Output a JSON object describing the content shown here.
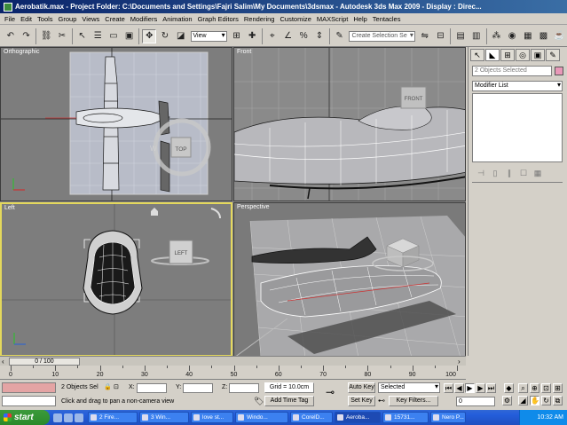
{
  "window": {
    "title": "Aerobatik.max   - Project Folder: C:\\Documents and Settings\\Fajri Salim\\My Documents\\3dsmax   - Autodesk 3ds Max  2009      - Display : Direc..."
  },
  "menu": [
    "File",
    "Edit",
    "Tools",
    "Group",
    "Views",
    "Create",
    "Modifiers",
    "Animation",
    "Graph Editors",
    "Rendering",
    "Customize",
    "MAXScript",
    "Help",
    "Tentacles"
  ],
  "toolbar": {
    "ref_coord": "View",
    "selection_set_placeholder": "Create Selection Se"
  },
  "viewports": {
    "top_left": {
      "label": "Orthographic",
      "cube": "TOP"
    },
    "top_right": {
      "label": "Front",
      "cube": "FRONT"
    },
    "bottom_left": {
      "label": "Left",
      "cube": "LEFT"
    },
    "bottom_right": {
      "label": "Perspective"
    }
  },
  "command_panel": {
    "selection_name": "2 Objects Selected",
    "modifier_list": "Modifier List",
    "swatch_color": "#e898b8"
  },
  "timeline": {
    "frame_display": "0 / 100",
    "ticks": [
      "0",
      "10",
      "20",
      "30",
      "40",
      "50",
      "60",
      "70",
      "80",
      "90",
      "100"
    ]
  },
  "status": {
    "selection": "2 Objects Sel",
    "x_label": "X:",
    "y_label": "Y:",
    "z_label": "Z:",
    "grid": "Grid = 10.0cm",
    "prompt": "Click and drag to pan a non-camera view",
    "add_time_tag": "Add Time Tag",
    "auto_key": "Auto Key",
    "set_key": "Set Key",
    "key_mode": "Selected",
    "key_filters": "Key Filters...",
    "current_frame": "0"
  },
  "taskbar": {
    "start": "start",
    "tasks": [
      "2 Fire...",
      "3 Win...",
      "love st...",
      "Windo...",
      "CorelD...",
      "Aeroba...",
      "15731...",
      "Nero P..."
    ],
    "clock": "10:32 AM"
  }
}
